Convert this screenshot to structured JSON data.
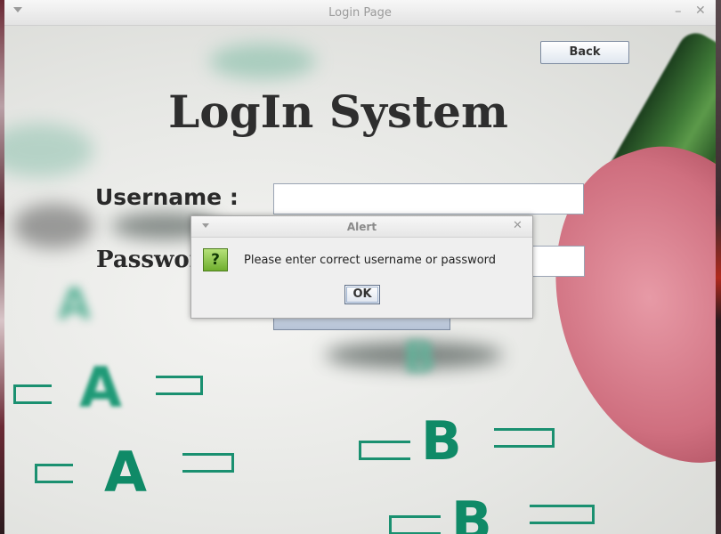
{
  "window": {
    "title": "Login Page"
  },
  "heading": "LogIn System",
  "back_button": "Back",
  "form": {
    "username_label": "Username :",
    "password_label": "Password :",
    "username_value": "",
    "password_value": ""
  },
  "alert": {
    "title": "Alert",
    "icon": "question-icon",
    "message": "Please enter correct username or password",
    "ok_label": "OK"
  },
  "background": {
    "letters": [
      "A",
      "A",
      "A",
      "B",
      "B",
      "B"
    ]
  }
}
